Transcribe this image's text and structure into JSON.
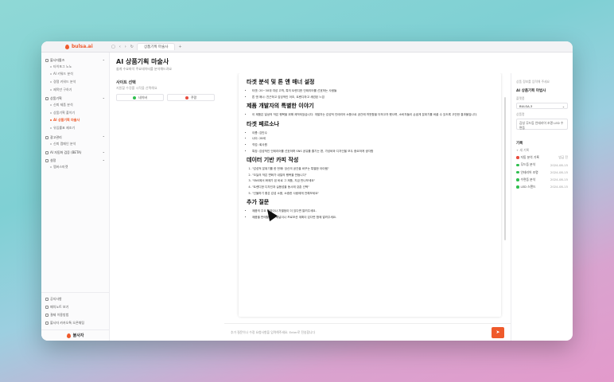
{
  "app": {
    "brand": "bulsa.ai",
    "tab_title": "상품기획 마술사",
    "bottom_brand": "불사자"
  },
  "colors": {
    "accent": "#ef5a2b",
    "green": "#2fbf4f",
    "red": "#e84b3c"
  },
  "sidebar": {
    "sections": [
      {
        "label": "불사자툴즈",
        "items": [
          "타이포그 노노",
          "AI 키워드 분석",
          "경쟁 키워드 분석",
          "제목만 구하기"
        ]
      },
      {
        "label": "상품기획",
        "items": [
          "신뢰 제품 분석",
          "상품기획 풀이기",
          "AI 상품기획 마술사",
          "유입률표 제조기"
        ]
      },
      {
        "label": "광고관리",
        "items": [
          "신뢰 캠페인 분석"
        ]
      },
      {
        "label": "AI 자동화 검증 (BETA)",
        "items": []
      },
      {
        "label": "설정",
        "items": [
          "멤버스마켓"
        ]
      }
    ],
    "active_item": "AI 상품기획 마술사",
    "bottom_items": [
      "공지사항",
      "패치노트 보기",
      "결제 이용방법",
      "불사자 카카오톡 오픈채팅"
    ]
  },
  "page": {
    "title": "AI 상품기획 마술사",
    "subtitle": "쉽게 수요파악 주요데이터를 분석해드려요"
  },
  "left_panel": {
    "title": "사이트 선택",
    "desc": "지원할 수정를 시작을 선택해요",
    "options": [
      "네이버",
      "쿠팡"
    ]
  },
  "doc": {
    "sections": [
      {
        "heading": "타겟 분석 및 톤 앤 매너 설정",
        "list": "ul",
        "items": [
          "타겟: 20~30대 여성 고객, 특히 트렌디한 인테리어를 선호하는 사람들",
          "톤 앤 매너: 친근하고 감성적인 어조, 트렌디하고 세련된 느낌"
        ]
      },
      {
        "heading": "제품 개발자의 특별한 이야기",
        "list": "ul",
        "items": [
          "이 제품은 일상의 작은 행복을 위해 제작되었습니다. 개발자는 감성적 인테리어 소품으로 공간에 따뜻함을 더하고자 했으며, 소비자들이 손쉽게 분위기를 바꿀 수 있도록 고안한 결과물입니다."
        ]
      },
      {
        "heading": "타겟 페르소나",
        "list": "ul",
        "items": [
          "이름: 김민수",
          "나이: 28세",
          "직업: 회사원",
          "특징: 감성적인 인테리어를 선호하며 SNS 공유를 즐기는 편, 가성비와 디자인을 모두 중요하게 생각함"
        ]
      },
      {
        "heading": "데이터 기반 카피 작성",
        "list": "ol",
        "items": [
          "\"감성적 분위기를 한 번에! 당신의 공간을 바꾸는 특별한 아이템\"",
          "\"오늘의 작은 변화가 내일의 행복을 만듭니다\"",
          "\"SNS에서 화제가 된 바로 그 제품, 지금 만나보세요\"",
          "\"트렌디한 디자인과 실용성을 동시에 갖춘 선택\"",
          "\"선물하기 좋은 감성 소품, 소중한 사람에게 전해보세요\""
        ]
      },
      {
        "heading": "추가 질문",
        "list": "ul",
        "items": [
          "제품의 주요 특징이나 차별점이 더 있다면 알려주세요.",
          "제품을 판매할 주요 채널이나 프로모션 계획이 있다면 함께 알려주세요."
        ]
      }
    ]
  },
  "input": {
    "placeholder": "추가 질문이나 수정 요청사항을 입력해주세요. Enter로 전송합니다"
  },
  "right_panel": {
    "hint": "상품 정보를 입력해 주세요",
    "title": "AI 상품기획 마법사",
    "platform_label": "플랫폼",
    "platform_value": "BULSA-3",
    "text_label": "상품명",
    "text_value": "감성 무드등 인테리어 조명 LED 수면등",
    "history_title": "기록",
    "history_new": "+ 새 기록",
    "history": [
      {
        "name": "자동 분석 기록",
        "date": "방금 전",
        "color": "#e84b3c"
      },
      {
        "name": "무드등 분석",
        "date": "2024-08-15",
        "color": "#2fbf4f"
      },
      {
        "name": "인테리어 조명",
        "date": "2024-08-15",
        "color": "#2fbf4f"
      },
      {
        "name": "수면등 분석",
        "date": "2024-08-15",
        "color": "#2fbf4f"
      },
      {
        "name": "LED 스탠드",
        "date": "2024-08-15",
        "color": "#2fbf4f"
      }
    ]
  }
}
